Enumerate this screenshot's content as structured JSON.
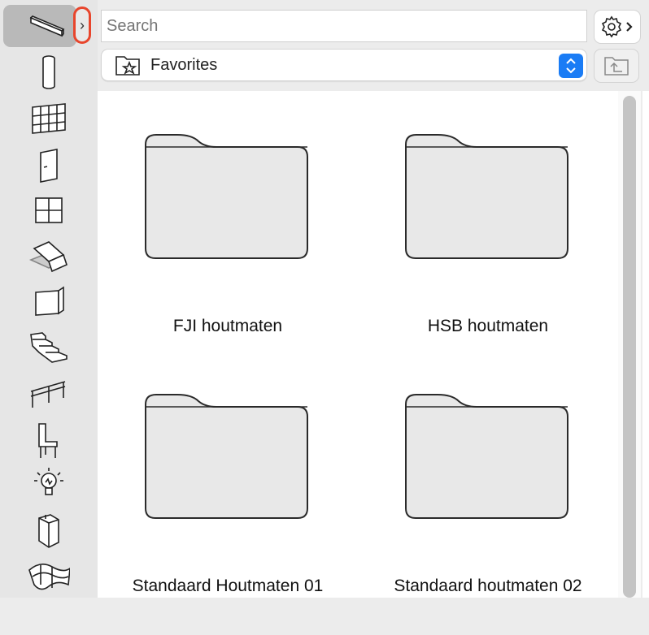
{
  "search": {
    "placeholder": "Search"
  },
  "library": {
    "selected": "Favorites"
  },
  "folders": [
    {
      "name": "FJI houtmaten"
    },
    {
      "name": "HSB houtmaten"
    },
    {
      "name": "Standaard Houtmaten 01"
    },
    {
      "name": "Standaard houtmaten 02"
    }
  ],
  "tools": [
    "beam-icon",
    "column-icon",
    "curtain-wall-icon",
    "door-icon",
    "window-icon",
    "slab-icon",
    "wall-icon",
    "stair-icon",
    "railing-icon",
    "chair-icon",
    "lamp-icon",
    "equipment-icon",
    "mesh-icon"
  ],
  "colors": {
    "accent": "#1a7cf5",
    "highlight": "#e8452c"
  }
}
